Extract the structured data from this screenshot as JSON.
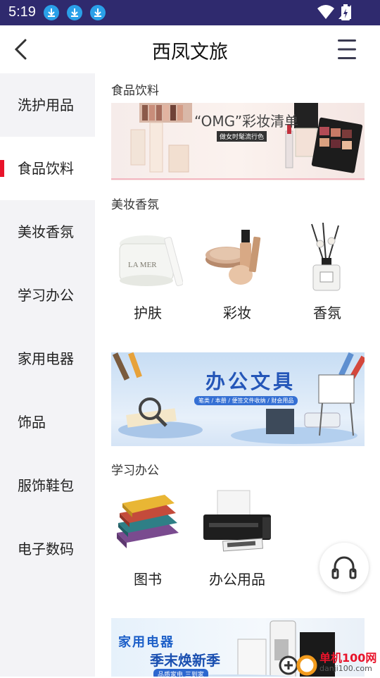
{
  "status_bar": {
    "time": "5:19"
  },
  "header": {
    "title": "西凤文旅"
  },
  "sidebar": {
    "items": [
      {
        "label": "洗护用品"
      },
      {
        "label": "食品饮料"
      },
      {
        "label": "美妆香氛"
      },
      {
        "label": "学习办公"
      },
      {
        "label": "家用电器"
      },
      {
        "label": "饰品"
      },
      {
        "label": "服饰鞋包"
      },
      {
        "label": "电子数码"
      }
    ],
    "active_index": 1
  },
  "main": {
    "section1": {
      "title": "食品饮料",
      "banner": {
        "title": "“OMG”彩妆清单",
        "subtitle": "做女时髦流行色"
      }
    },
    "section2": {
      "title": "美妆香氛",
      "categories": [
        {
          "label": "护肤",
          "product_text": "LA MER"
        },
        {
          "label": "彩妆"
        },
        {
          "label": "香氛"
        }
      ],
      "banner": {
        "title": "办公文具",
        "subtitle": "笔类 / 本册 / 便签文件收纳 / 财会用品"
      }
    },
    "section3": {
      "title": "学习办公",
      "categories": [
        {
          "label": "图书"
        },
        {
          "label": "办公用品"
        }
      ],
      "banner": {
        "title1": "家用电器",
        "title2": "季末焕新季",
        "subtitle": "品质家电 三到家"
      }
    }
  },
  "watermark": {
    "text": "单机100网",
    "url": "danji100.com"
  },
  "colors": {
    "status_bar": "#2f2a6e",
    "accent": "#e8132a",
    "sidebar_bg": "#f3f3f6"
  }
}
